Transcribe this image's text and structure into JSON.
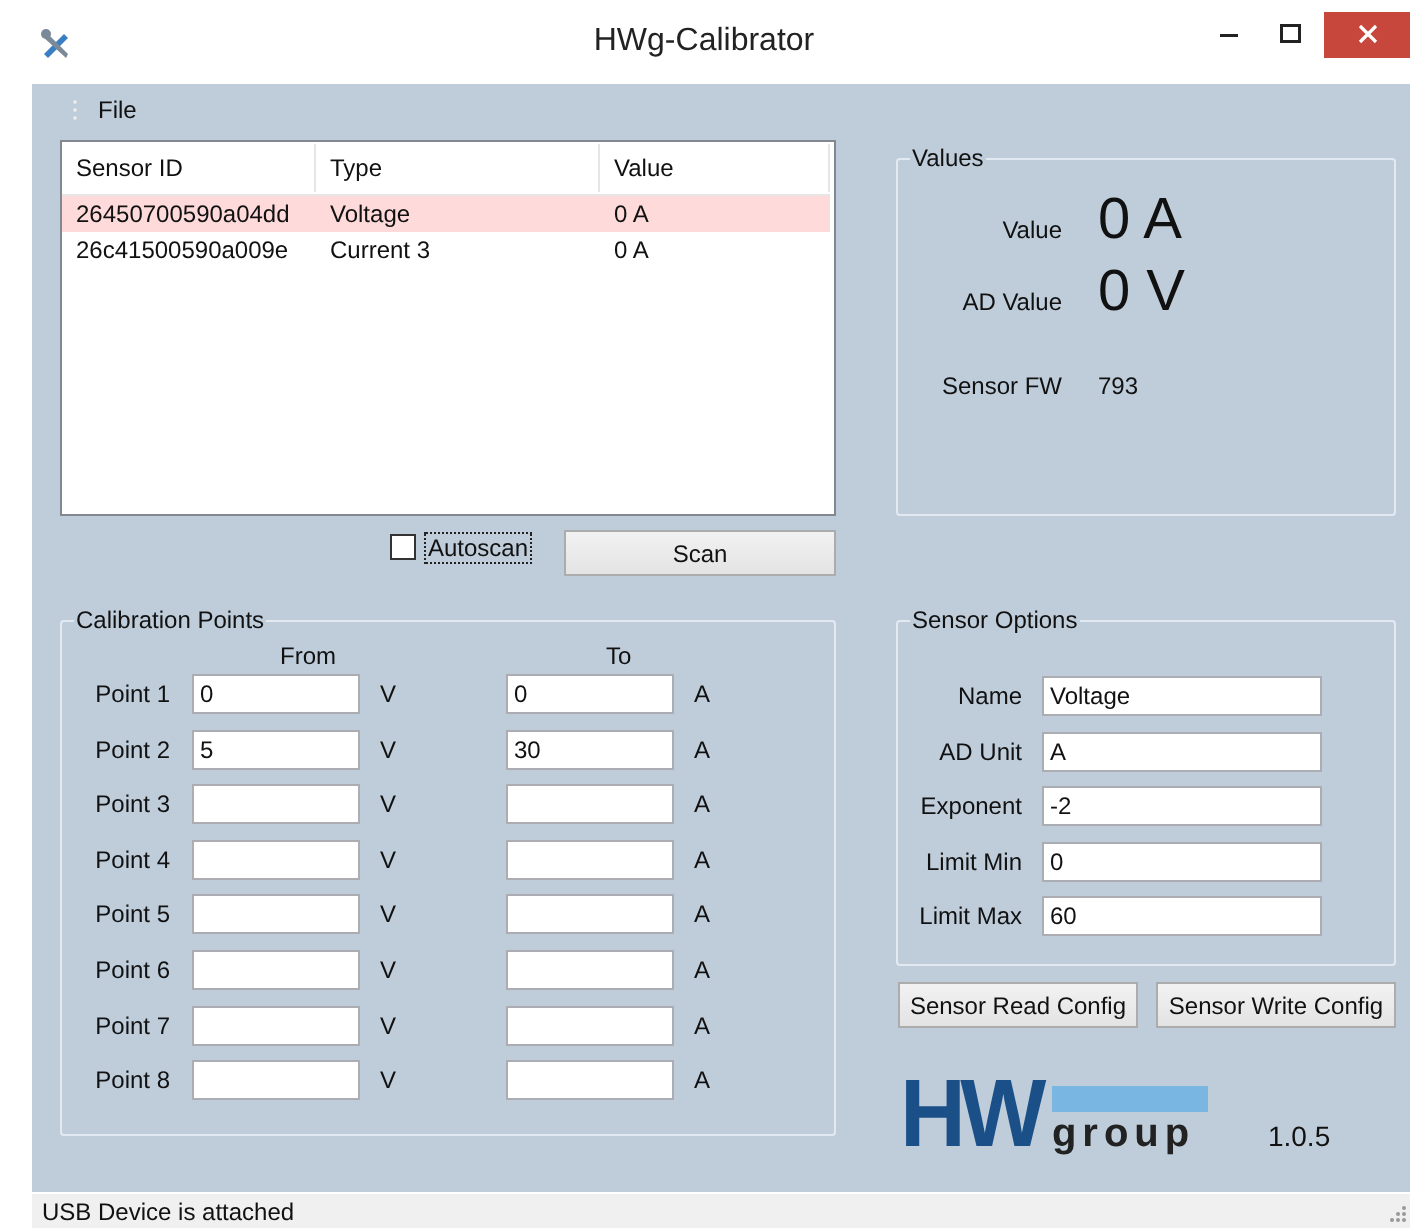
{
  "window": {
    "title": "HWg-Calibrator"
  },
  "menu": [
    {
      "label": "File"
    }
  ],
  "sensor_list": {
    "columns": [
      "Sensor ID",
      "Type",
      "Value"
    ],
    "rows": [
      {
        "cells": [
          "26450700590a04dd",
          "Voltage",
          "0 A"
        ],
        "selected": true
      },
      {
        "cells": [
          "26c41500590a009e",
          "Current 3",
          "0 A"
        ],
        "selected": false
      }
    ]
  },
  "autoscan": {
    "label": "Autoscan",
    "checked": false,
    "focused": true
  },
  "scan_button": "Scan",
  "calibration": {
    "title": "Calibration Points",
    "from_header": "From",
    "to_header": "To",
    "points": [
      {
        "label": "Point 1",
        "from": "0",
        "from_unit": "V",
        "to": "0",
        "to_unit": "A"
      },
      {
        "label": "Point 2",
        "from": "5",
        "from_unit": "V",
        "to": "30",
        "to_unit": "A"
      },
      {
        "label": "Point 3",
        "from_unit": "V",
        "to_unit": "A"
      },
      {
        "label": "Point 4",
        "from_unit": "V",
        "to_unit": "A"
      },
      {
        "label": "Point 5",
        "from_unit": "V",
        "to_unit": "A"
      },
      {
        "label": "Point 6",
        "from_unit": "V",
        "to_unit": "A"
      },
      {
        "label": "Point 7",
        "from_unit": "V",
        "to_unit": "A"
      },
      {
        "label": "Point 8",
        "from_unit": "V",
        "to_unit": "A"
      }
    ]
  },
  "values": {
    "title": "Values",
    "value_label": "Value",
    "value": "0 A",
    "ad_label": "AD Value",
    "ad_value": "0 V",
    "fw_label": "Sensor FW",
    "fw": "793"
  },
  "sensor_options": {
    "title": "Sensor Options",
    "fields": [
      {
        "label": "Name",
        "value": "Voltage"
      },
      {
        "label": "AD Unit",
        "value": "A"
      },
      {
        "label": "Exponent",
        "value": "-2"
      },
      {
        "label": "Limit Min",
        "value": "0"
      },
      {
        "label": "Limit Max",
        "value": "60"
      }
    ]
  },
  "buttons": [
    "Sensor Read Config",
    "Sensor Write Config"
  ],
  "logo": {
    "mark": "HW",
    "word": "group"
  },
  "version": "1.0.5",
  "status_bar": "USB Device is attached"
}
